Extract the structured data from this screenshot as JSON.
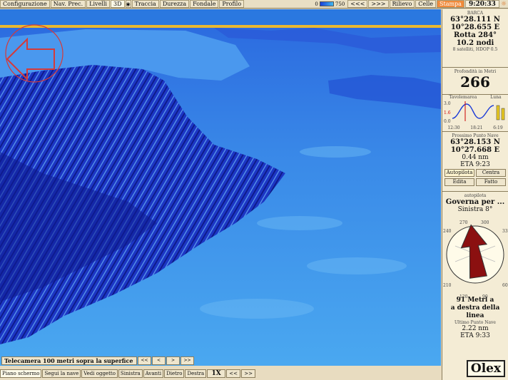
{
  "menu": {
    "configurazione": "Configurazione",
    "nav_prec": "Nav. Prec.",
    "livelli": "Livelli",
    "3d": "3D",
    "traccia": "Traccia",
    "durezza": "Durezza",
    "fondale": "Fondale",
    "profilo": "Profilo",
    "legend_min": "0",
    "legend_max": "750",
    "rew": "<<<",
    "ffw": ">>>",
    "rilievo": "Rilievo",
    "celle": "Celle",
    "stampa": "Stampa",
    "time": "9:20:33"
  },
  "boat": {
    "header": "BARCA",
    "lat": "63°28.111 N",
    "lon": "10°28.655 E",
    "rotta": "Rotta 284°",
    "speed": "10.2 nodi",
    "sat": "8 satelliti, HDOP 0.5"
  },
  "depth": {
    "label": "Profondità in Metri",
    "value": "266"
  },
  "tide": {
    "title_left": "Tavolemarea",
    "title_right": "Luna",
    "yvals": [
      "3.0",
      "1.6",
      "0.0"
    ],
    "times": [
      "12:30",
      "18:21",
      "6:19"
    ]
  },
  "waypoint": {
    "header": "Prossimo Punto Nave",
    "lat": "63°28.153 N",
    "lon": "10°27.668 E",
    "dist": "0.44 nm",
    "eta": "ETA 9:23",
    "btn_autopilota": "Autopilota",
    "btn_centra": "Centra",
    "btn_edita": "Edita",
    "btn_fatto": "Fatto"
  },
  "autopilot": {
    "label": "autopilota",
    "mode": "Governa per ...",
    "turn": "Sinistra 8°",
    "compass": [
      "270",
      "300",
      "330",
      "240",
      "60",
      "210",
      "120",
      "90"
    ],
    "offset": "91 Metri a",
    "offset2": "a destra della linea",
    "last_label": "Ultimo Punto Nave",
    "last_dist": "2.22 nm",
    "last_eta": "ETA 9:33"
  },
  "camera": {
    "label": "Telecamera 100 metri sopra la superfice",
    "b1": "<<",
    "b2": "<",
    "b3": ">",
    "b4": ">>"
  },
  "bottom": {
    "piano": "Piano schermo",
    "segui": "Segui la nave",
    "vedi": "Vedi oggetto",
    "sinistra": "Sinistra",
    "avanti": "Avanti",
    "dietro": "Dietro",
    "destra": "Destra",
    "zoom": "1X",
    "rew": "<<",
    "ffw": ">>"
  },
  "brand": "Olex",
  "colors": {
    "sea_light": "#4aa8f0",
    "sea_dark": "#1428b8",
    "accent_orange": "#f08a3a",
    "arrow_red": "#8b1010"
  }
}
